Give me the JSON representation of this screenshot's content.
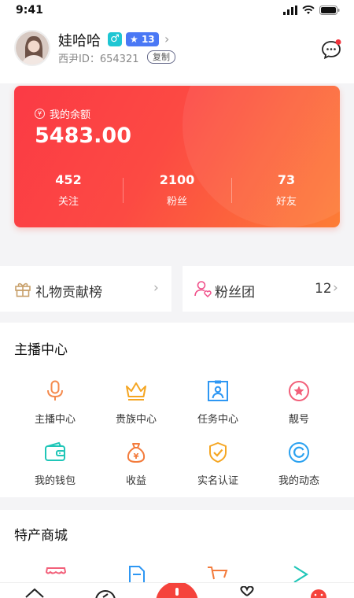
{
  "status_bar": {
    "time": "9:41"
  },
  "profile": {
    "nickname": "娃哈哈",
    "gender_symbol": "♂",
    "level": "13",
    "id_label": "西尹ID：",
    "id_value": "654321",
    "copy_label": "复制"
  },
  "balance": {
    "label": "我的余额",
    "amount": "5483.00",
    "stats": [
      {
        "value": "452",
        "label": "关注"
      },
      {
        "value": "2100",
        "label": "粉丝"
      },
      {
        "value": "73",
        "label": "好友"
      }
    ]
  },
  "cards": {
    "gift_label": "礼物贡献榜",
    "fans_label": "粉丝团",
    "fans_count": "12"
  },
  "anchor_center": {
    "title": "主播中心",
    "items": [
      {
        "label": "主播中心",
        "icon": "microphone-icon"
      },
      {
        "label": "贵族中心",
        "icon": "crown-icon"
      },
      {
        "label": "任务中心",
        "icon": "task-icon"
      },
      {
        "label": "靓号",
        "icon": "star-badge-icon"
      },
      {
        "label": "我的钱包",
        "icon": "wallet-icon"
      },
      {
        "label": "收益",
        "icon": "money-bag-icon"
      },
      {
        "label": "实名认证",
        "icon": "shield-check-icon"
      },
      {
        "label": "我的动态",
        "icon": "moments-icon"
      }
    ]
  },
  "mall": {
    "title": "特产商城"
  },
  "colors": {
    "accent_red": "#fb3a45",
    "accent_orange": "#fd7d36",
    "level_blue": "#4a78f5",
    "gender_teal": "#1ec6d3"
  }
}
